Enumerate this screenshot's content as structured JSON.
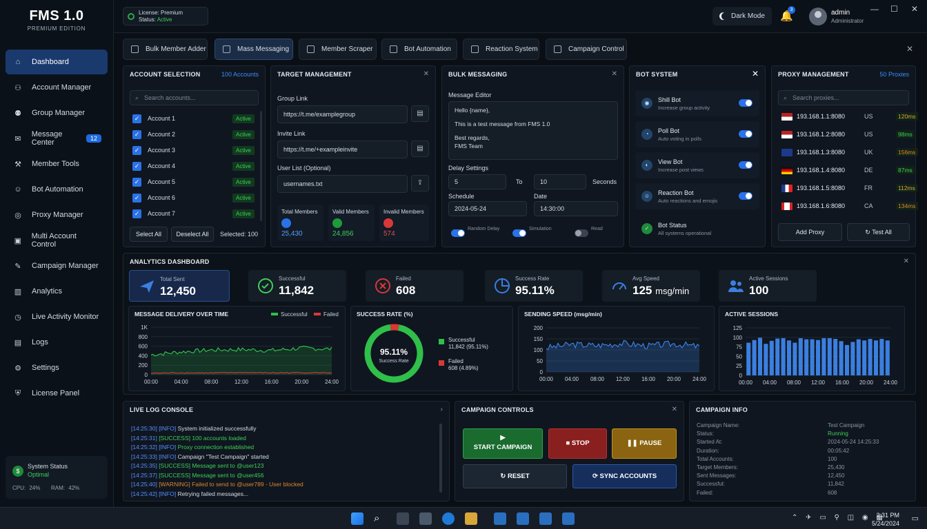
{
  "app": {
    "title": "FMS 1.0",
    "edition": "PREMIUM EDITION"
  },
  "nav": [
    {
      "label": "Dashboard",
      "icon": "home-icon"
    },
    {
      "label": "Account Manager",
      "icon": "user-cog-icon"
    },
    {
      "label": "Group Manager",
      "icon": "group-icon"
    },
    {
      "label": "Message Center",
      "icon": "mail-icon",
      "badge": "12"
    },
    {
      "label": "Member Tools",
      "icon": "tools-icon"
    },
    {
      "label": "Bot Automation",
      "icon": "robot-icon"
    },
    {
      "label": "Proxy Manager",
      "icon": "globe-icon"
    },
    {
      "label": "Multi Account Control",
      "icon": "multi-account-icon"
    },
    {
      "label": "Campaign Manager",
      "icon": "campaign-icon"
    },
    {
      "label": "Analytics",
      "icon": "chart-icon"
    },
    {
      "label": "Live Activity Monitor",
      "icon": "activity-icon"
    },
    {
      "label": "Logs",
      "icon": "logs-icon"
    },
    {
      "label": "Settings",
      "icon": "gear-icon"
    },
    {
      "label": "License Panel",
      "icon": "license-icon"
    }
  ],
  "system": {
    "label": "System Status",
    "status": "Optimal",
    "cpu": "CPU: 24%",
    "ram": "RAM: 42%"
  },
  "header": {
    "license": "License: Premium",
    "license_status_label": "Status:",
    "license_status": "Active",
    "dark_mode": "Dark Mode",
    "notifications": "3",
    "user": "admin",
    "role": "Administrator"
  },
  "tabs": [
    "Bulk Member Adder",
    "Mass Messaging",
    "Member Scraper",
    "Bot Automation",
    "Reaction System",
    "Campaign Control"
  ],
  "account_selection": {
    "title": "ACCOUNT SELECTION",
    "count": "100 Accounts",
    "search_placeholder": "Search accounts...",
    "accounts": [
      {
        "name": "Account 1",
        "status": "Active"
      },
      {
        "name": "Account 2",
        "status": "Active"
      },
      {
        "name": "Account 3",
        "status": "Active"
      },
      {
        "name": "Account 4",
        "status": "Active"
      },
      {
        "name": "Account 5",
        "status": "Active"
      },
      {
        "name": "Account 6",
        "status": "Active"
      },
      {
        "name": "Account 7",
        "status": "Active"
      }
    ],
    "select_all": "Select All",
    "deselect_all": "Deselect All",
    "selected": "Selected: 100"
  },
  "target": {
    "title": "TARGET MANAGEMENT",
    "group_label": "Group Link",
    "group_value": "https://t.me/examplegroup",
    "invite_label": "Invite Link",
    "invite_value": "https://t.me/+exampleinvite",
    "userlist_label": "User List (Optional)",
    "userlist_value": "usernames.txt",
    "total_label": "Total Members",
    "total": "25,430",
    "valid_label": "Valid Members",
    "valid": "24,856",
    "invalid_label": "Invalid Members",
    "invalid": "574"
  },
  "bulk": {
    "title": "BULK MESSAGING",
    "editor_label": "Message Editor",
    "message_lines": [
      "Hello {name},",
      "This is a test message from FMS 1.0",
      "Best regards,",
      "FMS Team"
    ],
    "delay_label": "Delay Settings",
    "delay_from": "5",
    "to": "To",
    "delay_to": "10",
    "unit": "Seconds",
    "schedule_label": "Schedule",
    "date_label": "Date",
    "date": "2024-05-24",
    "time": "14:30:00",
    "toggle1": "Random Delay",
    "toggle2": "Simulation",
    "toggle3": "Read"
  },
  "bots": {
    "title": "BOT SYSTEM",
    "items": [
      {
        "name": "Shill Bot",
        "desc": "Increase group activity",
        "on": true
      },
      {
        "name": "Poll Bot",
        "desc": "Auto voting in polls",
        "on": true
      },
      {
        "name": "View Bot",
        "desc": "Increase post views",
        "on": true
      },
      {
        "name": "Reaction Bot",
        "desc": "Auto reactions and emojis",
        "on": true
      }
    ],
    "status_label": "Bot Status",
    "status": "All systems operational"
  },
  "proxy": {
    "title": "PROXY MANAGEMENT",
    "count": "50 Proxies",
    "search_placeholder": "Search proxies...",
    "items": [
      {
        "ip": "193.168.1.1:8080",
        "cc": "US",
        "ms": "120ms",
        "color": "#d9a63a"
      },
      {
        "ip": "193.168.1.2:8080",
        "cc": "US",
        "ms": "98ms",
        "color": "#3fcf5a"
      },
      {
        "ip": "193.168.1.3:8080",
        "cc": "UK",
        "ms": "156ms",
        "color": "#e0842e"
      },
      {
        "ip": "193.168.1.4:8080",
        "cc": "DE",
        "ms": "87ms",
        "color": "#3fcf5a"
      },
      {
        "ip": "193.168.1.5:8080",
        "cc": "FR",
        "ms": "112ms",
        "color": "#d9a63a"
      },
      {
        "ip": "193.168.1.6:8080",
        "cc": "CA",
        "ms": "134ms",
        "color": "#e0842e"
      }
    ],
    "add": "Add Proxy",
    "test": "Test All"
  },
  "analytics": {
    "title": "ANALYTICS DASHBOARD",
    "kpis": [
      {
        "label": "Total Sent",
        "value": "12,450",
        "icon": "send-icon"
      },
      {
        "label": "Successful",
        "value": "11,842",
        "icon": "check-circle-icon"
      },
      {
        "label": "Failed",
        "value": "608",
        "icon": "x-circle-icon"
      },
      {
        "label": "Success Rate",
        "value": "95.11%",
        "icon": "pie-icon"
      },
      {
        "label": "Avg Speed",
        "value": "125",
        "unit": "msg/min",
        "icon": "gauge-icon"
      },
      {
        "label": "Active Sessions",
        "value": "100",
        "icon": "users-icon"
      }
    ]
  },
  "chart_data": [
    {
      "type": "line",
      "title": "MESSAGE DELIVERY OVER TIME",
      "x": [
        "00:00",
        "04:00",
        "08:00",
        "12:00",
        "16:00",
        "20:00",
        "24:00"
      ],
      "yticks": [
        "1K",
        "800",
        "600",
        "400",
        "200",
        "0"
      ],
      "ylim": [
        0,
        1000
      ],
      "series": [
        {
          "name": "Successful",
          "color": "#2fbf4a",
          "values": [
            420,
            480,
            520,
            530,
            510,
            560,
            540
          ]
        },
        {
          "name": "Failed",
          "color": "#d93838",
          "values": [
            30,
            40,
            35,
            45,
            38,
            42,
            40
          ]
        }
      ],
      "legend": "top-right"
    },
    {
      "type": "pie",
      "title": "SUCCESS RATE (%)",
      "center": "95.11%",
      "center_label": "Success Rate",
      "slices": [
        {
          "name": "Successful",
          "value": 11842,
          "pct": "95.11%",
          "color": "#2fbf4a",
          "label": "11,842 (95.11%)"
        },
        {
          "name": "Failed",
          "value": 608,
          "pct": "4.89%",
          "color": "#d93838",
          "label": "608 (4.89%)"
        }
      ]
    },
    {
      "type": "line",
      "title": "SENDING SPEED (msg/min)",
      "x": [
        "00:00",
        "04:00",
        "08:00",
        "12:00",
        "16:00",
        "20:00",
        "24:00"
      ],
      "yticks": [
        "200",
        "150",
        "100",
        "50",
        "0"
      ],
      "ylim": [
        0,
        200
      ],
      "series": [
        {
          "name": "",
          "color": "#3b7fe0",
          "values": [
            110,
            125,
            120,
            130,
            118,
            128,
            115
          ]
        }
      ]
    },
    {
      "type": "bar",
      "title": "ACTIVE SESSIONS",
      "x": [
        "00:00",
        "04:00",
        "08:00",
        "12:00",
        "16:00",
        "20:00",
        "24:00"
      ],
      "yticks": [
        "125",
        "100",
        "75",
        "50",
        "25",
        "0"
      ],
      "ylim": [
        0,
        125
      ],
      "values": [
        86,
        93,
        99,
        83,
        91,
        97,
        98,
        92,
        86,
        98,
        95,
        95,
        93,
        98,
        98,
        96,
        90,
        80,
        88,
        95,
        92,
        96,
        92,
        96,
        92
      ]
    }
  ],
  "log": {
    "title": "LIVE LOG CONSOLE",
    "lines": [
      {
        "t": "[14:25:30]",
        "lvl": "[INFO]",
        "msg": "System initialized successfully",
        "c": "#5a8dff",
        "mc": "#d6dde6"
      },
      {
        "t": "[14:25:31]",
        "lvl": "[SUCCESS]",
        "msg": "100 accounts loaded",
        "c": "#3fcf5a",
        "mc": "#3fcf5a"
      },
      {
        "t": "[14:25:32]",
        "lvl": "[INFO]",
        "msg": "Proxy connection established",
        "c": "#5a8dff",
        "mc": "#3fcf5a"
      },
      {
        "t": "[14:25:33]",
        "lvl": "[INFO]",
        "msg": "Campaign \"Test Campaign\" started",
        "c": "#5a8dff",
        "mc": "#d6dde6"
      },
      {
        "t": "[14:25:35]",
        "lvl": "[SUCCESS]",
        "msg": "Message sent to @user123",
        "c": "#3fcf5a",
        "mc": "#3fcf5a"
      },
      {
        "t": "[14:25:37]",
        "lvl": "[SUCCESS]",
        "msg": "Message sent to @user456",
        "c": "#3fcf5a",
        "mc": "#3fcf5a"
      },
      {
        "t": "[14:25:40]",
        "lvl": "[WARNING]",
        "msg": "Failed to send to @user789 - User blocked",
        "c": "#e0842e",
        "mc": "#e0842e"
      },
      {
        "t": "[14:25:42]",
        "lvl": "[INFO]",
        "msg": "Retrying failed messages...",
        "c": "#5a8dff",
        "mc": "#d6dde6"
      }
    ]
  },
  "controls": {
    "title": "CAMPAIGN CONTROLS",
    "start": "START CAMPAIGN",
    "stop": "STOP",
    "pause": "PAUSE",
    "reset": "RESET",
    "sync": "SYNC ACCOUNTS"
  },
  "info": {
    "title": "CAMPAIGN INFO",
    "rows": [
      {
        "k": "Campaign Name:",
        "v": "Test Campaign"
      },
      {
        "k": "Status:",
        "v": "Running"
      },
      {
        "k": "Started At:",
        "v": "2024-05-24 14:25:33"
      },
      {
        "k": "Duration:",
        "v": "00:05:42"
      },
      {
        "k": "Total Accounts:",
        "v": "100"
      },
      {
        "k": "Target Members:",
        "v": "25,430"
      },
      {
        "k": "Sent Messages:",
        "v": "12,450"
      },
      {
        "k": "Successful:",
        "v": "11,842"
      },
      {
        "k": "Failed:",
        "v": "608"
      }
    ]
  },
  "taskbar": {
    "time": "2:31 PM",
    "date": "5/24/2024"
  }
}
